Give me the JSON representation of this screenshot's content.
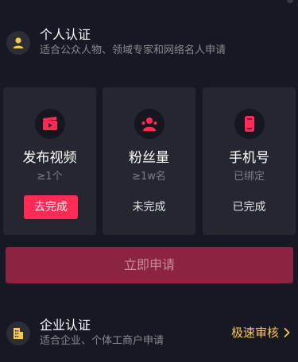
{
  "colors": {
    "background": "#161823",
    "card": "#25262f",
    "accent": "#fe2c55",
    "apply_button": "#8b2440",
    "fast_review": "#f8c84f"
  },
  "personal": {
    "icon": "user-icon",
    "title": "个人认证",
    "subtitle": "适合公众人物、领域专家和网络名人申请"
  },
  "cards": [
    {
      "icon": "video-clapper-icon",
      "title": "发布视频",
      "requirement": "≥1个",
      "status": "去完成",
      "status_actionable": true
    },
    {
      "icon": "fans-icon",
      "title": "粉丝量",
      "requirement": "≥1w名",
      "status": "未完成",
      "status_actionable": false
    },
    {
      "icon": "phone-icon",
      "title": "手机号",
      "requirement": "已绑定",
      "status": "已完成",
      "status_actionable": false
    }
  ],
  "apply_button": {
    "label": "立即申请"
  },
  "business": {
    "icon": "building-icon",
    "title": "企业认证",
    "subtitle": "适合企业、个体工商户申请",
    "action_label": "极速审核",
    "action_icon": "chevron-right-icon"
  }
}
